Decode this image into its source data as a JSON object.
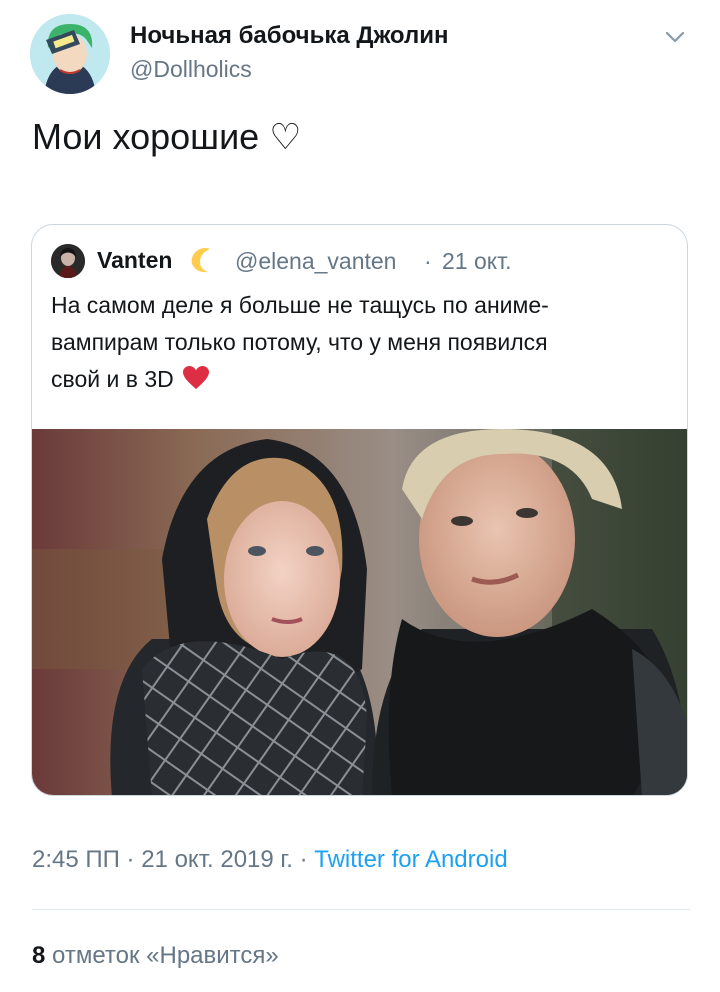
{
  "tweet": {
    "author": {
      "display_name": "Ночьная бабочька Джолин",
      "handle": "@Dollholics",
      "avatar": "avatar-icon"
    },
    "menu_icon": "chevron-down-icon",
    "text": "Мои хорошие ♡",
    "timestamp": "2:45 ПП · 21 окт. 2019 г.",
    "separator": "·",
    "client": "Twitter for Android",
    "likes": {
      "count": "8",
      "label": "отметок «Нравится»"
    }
  },
  "quote": {
    "display_name": "Vanten",
    "emoji": "moon-icon",
    "handle": "@elena_vanten",
    "separator": "·",
    "date": "21 окт.",
    "text_lines": [
      "На самом деле я больше не тащусь по аниме-",
      "вампирам только потому, что у меня появился",
      "свой и в 3D"
    ],
    "heart_icon": "red-heart-icon",
    "photo": "selfie-photo"
  },
  "colors": {
    "text_primary": "#14171a",
    "text_secondary": "#657786",
    "link": "#1da1f2",
    "border": "#ccd6dd",
    "heart": "#e0245e"
  }
}
